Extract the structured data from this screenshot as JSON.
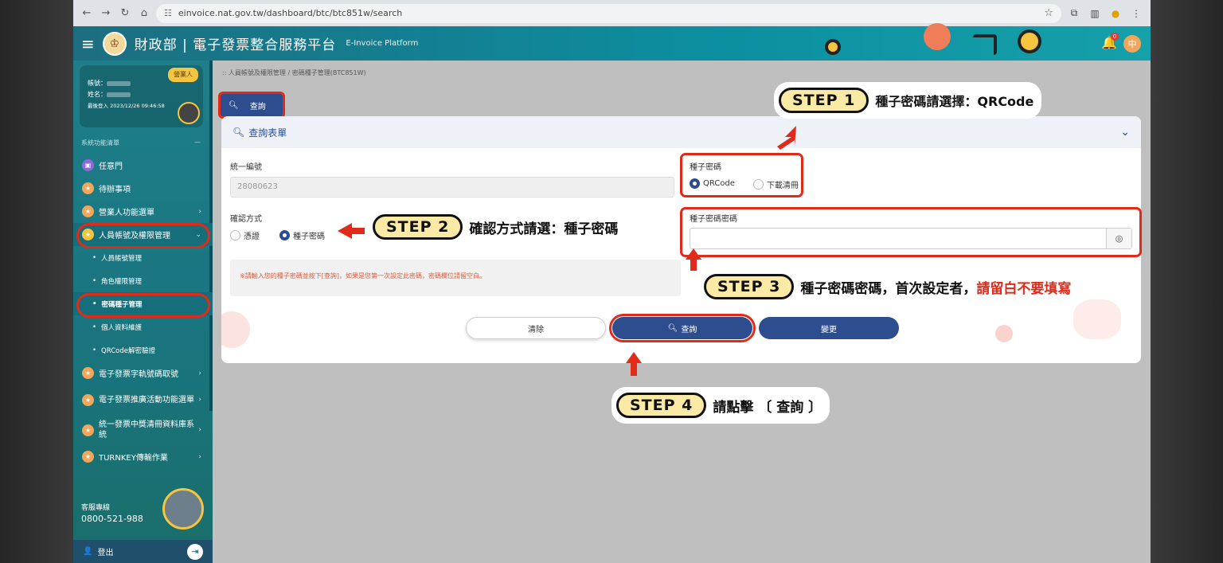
{
  "browser": {
    "url": "einvoice.nat.gov.tw/dashboard/btc/btc851w/search"
  },
  "header": {
    "brand": "財政部 | 電子發票整合服務平台",
    "brand_en": "E-Invoice Platform",
    "notif_count": "0",
    "user_initial": "中"
  },
  "sidebar": {
    "badge": "營業人",
    "account_label": "帳號：",
    "name_label": "姓名：",
    "last_login": "最後登入 2023/12/26 09:46:58",
    "menu_title": "系統功能清單",
    "menu_collapse": "—",
    "items": [
      {
        "label": "任意門"
      },
      {
        "label": "待辦事項"
      },
      {
        "label": "營業人功能選單"
      },
      {
        "label": "人員帳號及權限管理"
      },
      {
        "label": "人員帳號管理"
      },
      {
        "label": "角色權限管理"
      },
      {
        "label": "密碼種子管理"
      },
      {
        "label": "個人資料維護"
      },
      {
        "label": "QRCode解密驗證"
      },
      {
        "label": "電子發票字軌號碼取號"
      },
      {
        "label": "電子發票推廣活動功能選單"
      },
      {
        "label": "統一發票中獎清冊資料庫系統"
      },
      {
        "label": "TURNKEY傳輸作業"
      }
    ],
    "hotline_label": "客服專線",
    "hotline_number": "0800-521-988",
    "logout": "登出"
  },
  "main": {
    "breadcrumb": ":: 人員帳號及權限管理 / 密碼種子管理(BTC851W)",
    "query_tab": "查詢",
    "form_title": "查詢表單",
    "tax_id_label": "統一編號",
    "tax_id_value": "28080623",
    "verify_label": "確認方式",
    "verify_options": [
      "憑證",
      "種子密碼"
    ],
    "seed_label": "種子密碼",
    "seed_options": [
      "QRCode",
      "下載清冊"
    ],
    "seed_pwd_label": "種子密碼密碼",
    "note": "※請輸入您的種子密碼並按下[查詢]，如果是您第一次設定此密碼，密碼欄位請留空白。",
    "buttons": {
      "clear": "清除",
      "search": "查詢",
      "change": "變更"
    }
  },
  "callouts": {
    "step1": {
      "step": "STEP 1",
      "text": "種子密碼請選擇：QRCode"
    },
    "step2": {
      "step": "STEP 2",
      "text": "確認方式請選：種子密碼"
    },
    "step3": {
      "step": "STEP 3",
      "text": "種子密碼密碼，首次設定者，",
      "text_red": "請留白不要填寫"
    },
    "step4": {
      "step": "STEP 4",
      "text": "請點擊 〔 查詢 〕"
    }
  },
  "colors": {
    "primary": "#2d4d8f",
    "highlight": "#e02a1a",
    "header": "#0c8fa0"
  }
}
